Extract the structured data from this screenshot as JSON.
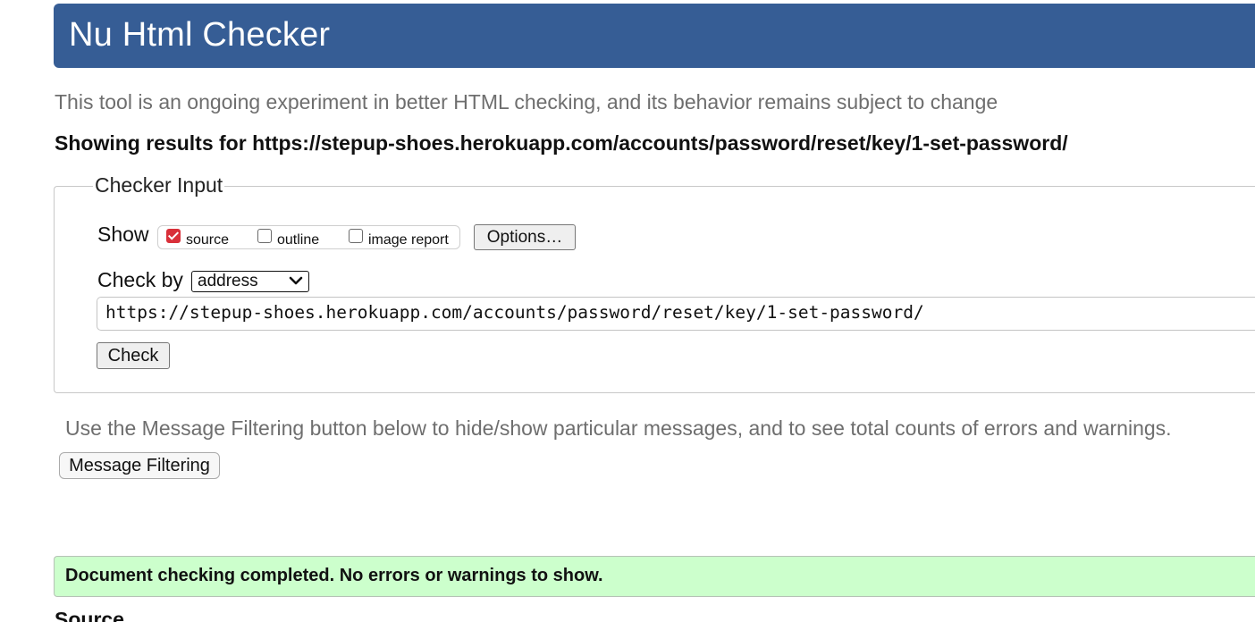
{
  "header": {
    "title": "Nu Html Checker",
    "background_color": "#365d95"
  },
  "intro_text": "This tool is an ongoing experiment in better HTML checking, and its behavior remains subject to change",
  "results_heading": "Showing results for https://stepup-shoes.herokuapp.com/accounts/password/reset/key/1-set-password/",
  "checker_input": {
    "legend": "Checker Input",
    "show_label": "Show",
    "show_options": [
      {
        "label": "source",
        "checked": true
      },
      {
        "label": "outline",
        "checked": false
      },
      {
        "label": "image report",
        "checked": false
      }
    ],
    "options_button_label": "Options…",
    "check_by_label": "Check by",
    "check_by_selected": "address",
    "address_value": "https://stepup-shoes.herokuapp.com/accounts/password/reset/key/1-set-password/",
    "check_button_label": "Check"
  },
  "filter_note": "Use the Message Filtering button below to hide/show particular messages, and to see total counts of errors and warnings.",
  "message_filtering_button_label": "Message Filtering",
  "success_message": "Document checking completed. No errors or warnings to show.",
  "success_color": "#ccffcc",
  "accent_checkbox_color": "#d9303a",
  "source_heading": "Source",
  "icons": {
    "checkbox_checked": "checkmark-icon",
    "select_arrow": "chevron-down-icon"
  }
}
